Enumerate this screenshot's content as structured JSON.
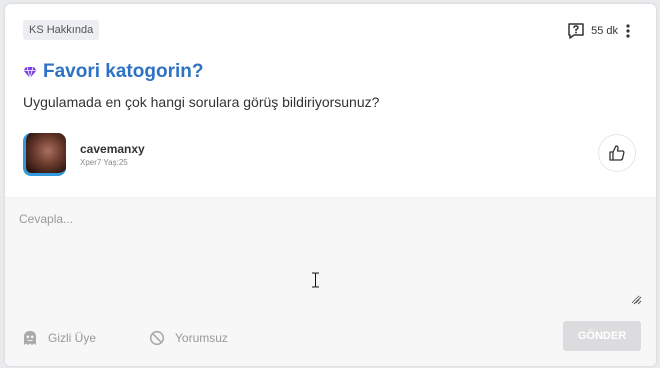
{
  "post": {
    "category_tag": "KS Hakkında",
    "time_ago": "55 dk",
    "title": "Favori katogorin?",
    "question": "Uygulamada en çok hangi sorulara görüş bildiriyorsunuz?",
    "author": {
      "name": "cavemanxy",
      "subtitle": "Xper7 Yaş:25"
    }
  },
  "reply": {
    "placeholder": "Cevapla...",
    "anonymous_label": "Gizli Üye",
    "no_comment_label": "Yorumsuz",
    "send_label": "GÖNDER"
  },
  "icons": {
    "question": "question-bubble-icon",
    "more": "kebab-menu-icon",
    "title": "gem-icon",
    "like": "thumbs-up-icon",
    "anonymous": "ghost-icon",
    "no_comment": "block-icon"
  },
  "colors": {
    "title": "#2f72c4",
    "gem": "#7b3fe4",
    "avatar_ring": "#3399dd",
    "send_button_disabled": "#dcdcde"
  }
}
